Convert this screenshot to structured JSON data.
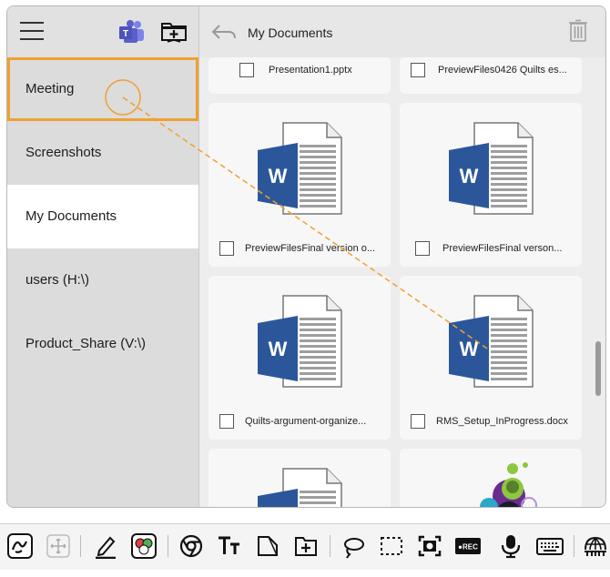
{
  "sidebar": {
    "items": [
      {
        "label": "Meeting"
      },
      {
        "label": "Screenshots"
      },
      {
        "label": "My Documents"
      },
      {
        "label": "users (H:\\)"
      },
      {
        "label": "Product_Share (V:\\)"
      }
    ]
  },
  "header": {
    "title": "My Documents"
  },
  "files": [
    {
      "name": "Presentation1.pptx"
    },
    {
      "name": "PreviewFiles0426 Quilts es..."
    },
    {
      "name": "PreviewFilesFinal version o..."
    },
    {
      "name": "PreviewFilesFinal verson..."
    },
    {
      "name": "Quilts-argument-organize..."
    },
    {
      "name": "RMS_Setup_InProgress.docx"
    }
  ],
  "word_letter": "W",
  "rec_label": "●REC",
  "colors": {
    "accent": "#f0a030",
    "word_blue": "#2b579a",
    "teams": "#5b5fc7"
  },
  "icons": [
    "menu-icon",
    "teams-icon",
    "add-folder-icon",
    "back-arrow-icon",
    "trash-icon",
    "draw-icon",
    "move-icon",
    "pen-icon",
    "color-palette-icon",
    "chrome-icon",
    "text-icon",
    "shape-icon",
    "add-folder-tool-icon",
    "lasso-icon",
    "select-rectangle-icon",
    "screenshot-icon",
    "record-icon",
    "microphone-icon",
    "keyboard-icon",
    "globe-icon"
  ]
}
